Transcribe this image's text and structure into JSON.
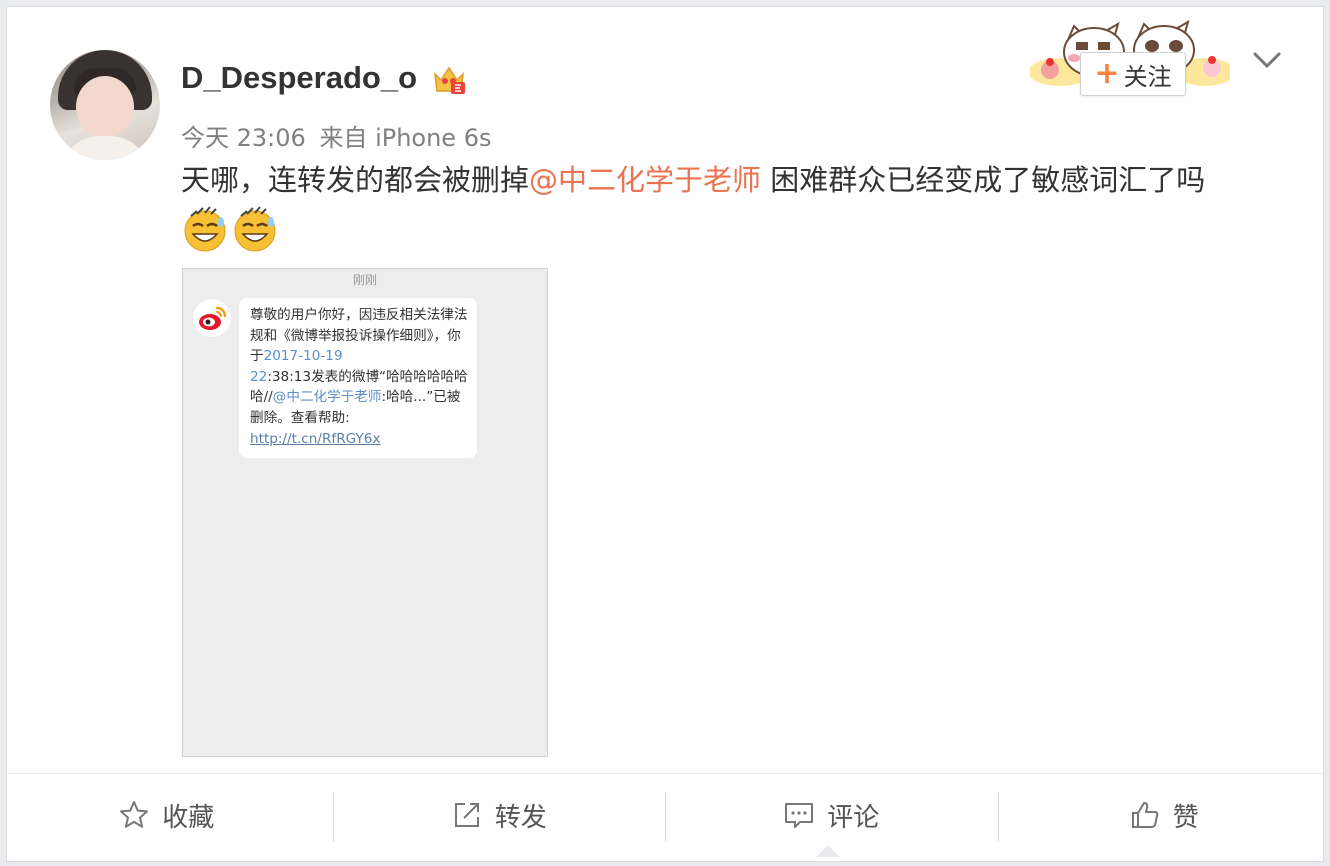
{
  "post": {
    "username": "D_Desperado_o",
    "time": "今天 23:06",
    "source": "来自 iPhone 6s",
    "text_before": "天哪，连转发的都会被删掉",
    "mention": "@中二化学于老师",
    "text_after": "困难群众已经变成了敏感词汇了吗",
    "emojis": [
      "laugh-sweat-icon",
      "laugh-sweat-icon"
    ]
  },
  "header": {
    "follow_label": "关注",
    "follow_plus": "+"
  },
  "screenshot": {
    "time": "刚刚",
    "msg_part1": "尊敬的用户你好，因违反相关法律法规和《微博举报投诉操作细则》，你于",
    "msg_date": "2017-10-19",
    "msg_part2": "22",
    "msg_part3": ":38:13发表的微博“哈哈哈哈哈哈哈//",
    "msg_mention": "@中二化学于老师",
    "msg_part4": ":哈哈...”已被删除。查看帮助:",
    "msg_link": "http://t.cn/RfRGY6x"
  },
  "actions": {
    "favorite": "收藏",
    "repost": "转发",
    "comment": "评论",
    "like": "赞"
  },
  "colors": {
    "mention": "#eb7350",
    "follow_plus": "#ff8140",
    "meta": "#808080",
    "background": "#e9ebee"
  }
}
